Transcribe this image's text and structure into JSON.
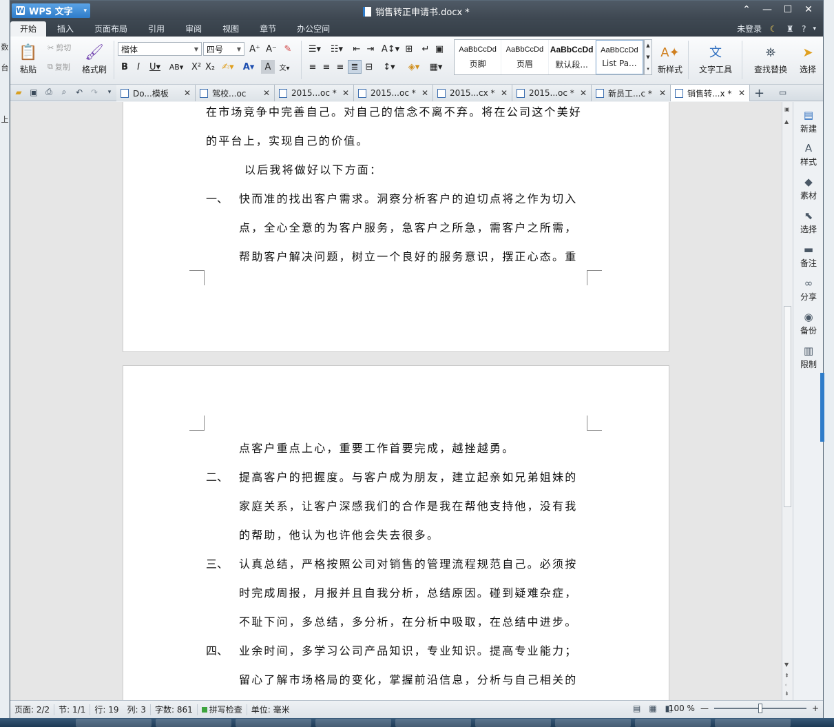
{
  "app": {
    "name": "WPS 文字",
    "doc_title": "销售转正申请书.docx *"
  },
  "menu": {
    "tabs": [
      "开始",
      "插入",
      "页面布局",
      "引用",
      "审阅",
      "视图",
      "章节",
      "办公空间"
    ],
    "active": "开始",
    "login": "未登录",
    "help": "?"
  },
  "ribbon": {
    "paste": "粘贴",
    "cut": "剪切",
    "copy": "复制",
    "format_painter": "格式刷",
    "font_name": "楷体",
    "font_size": "四号",
    "styles": [
      {
        "sample": "AaBbCcDd",
        "name": "页脚"
      },
      {
        "sample": "AaBbCcDd",
        "name": "页眉"
      },
      {
        "sample": "AaBbCcDd",
        "name": "默认段..."
      },
      {
        "sample": "AaBbCcDd",
        "name": "List Pa..."
      }
    ],
    "new_style": "新样式",
    "text_tools": "文字工具",
    "find_replace": "查找替换",
    "select": "选择"
  },
  "doc_tabs": [
    {
      "label": "Do...模板",
      "active": false
    },
    {
      "label": "驾校...oc",
      "active": false
    },
    {
      "label": "2015...oc *",
      "active": false
    },
    {
      "label": "2015...oc *",
      "active": false
    },
    {
      "label": "2015...cx *",
      "active": false
    },
    {
      "label": "2015...oc *",
      "active": false
    },
    {
      "label": "新员工...c *",
      "active": false
    },
    {
      "label": "销售转...x *",
      "active": true
    }
  ],
  "document": {
    "page1_lines": [
      "在市场竞争中完善自己。对自己的信念不离不弃。将在公司这个美好",
      "的平台上，实现自己的价值。",
      "以后我将做好以下方面：",
      "快而准的找出客户需求。洞察分析客户的迫切点将之作为切入",
      "点，全心全意的为客户服务，急客户之所急，需客户之所需，",
      "帮助客户解决问题，树立一个良好的服务意识，摆正心态。重"
    ],
    "page2_lines": [
      "点客户重点上心，重要工作首要完成，越挫越勇。",
      "提高客户的把握度。与客户成为朋友，建立起亲如兄弟姐妹的",
      "家庭关系，让客户深感我们的合作是我在帮他支持他，没有我",
      "的帮助，他认为也许他会失去很多。",
      "认真总结，严格按照公司对销售的管理流程规范自己。必须按",
      "时完成周报，月报并且自我分析，总结原因。碰到疑难杂症，",
      "不耻下问，多总结，多分析，在分析中吸取，在总结中进步。",
      "业余时间，多学习公司产品知识，专业知识。提高专业能力；",
      "留心了解市场格局的变化，掌握前沿信息，分析与自己相关的"
    ],
    "numbers": [
      "一、",
      "二、",
      "三、",
      "四、"
    ]
  },
  "side_panel": [
    "新建",
    "样式",
    "素材",
    "选择",
    "备注",
    "分享",
    "备份",
    "限制"
  ],
  "status": {
    "page": "页面: 2/2",
    "section": "节: 1/1",
    "row": "行: 19",
    "col": "列: 3",
    "words": "字数: 861",
    "spell": "拼写检查",
    "unit": "单位: 毫米",
    "zoom": "100 %"
  }
}
